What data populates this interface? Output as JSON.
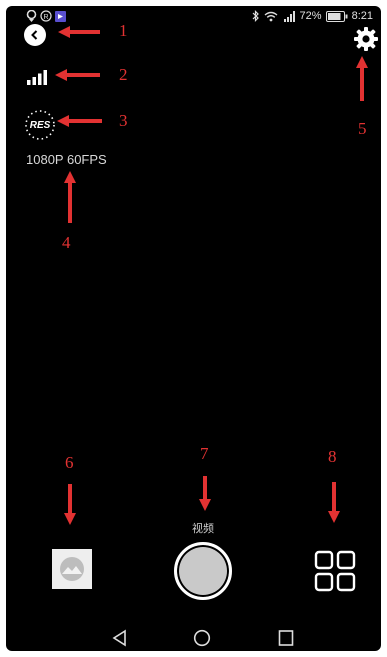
{
  "status_bar": {
    "battery_percent": "72%",
    "time": "8:21"
  },
  "camera": {
    "resolution_badge": "RES",
    "resolution_text": "1080P 60FPS",
    "mode_label": "视频"
  },
  "annotations": {
    "labels": [
      "1",
      "2",
      "3",
      "4",
      "5",
      "6",
      "7",
      "8"
    ],
    "color": "#e23232"
  },
  "icons": {
    "back": "back-arrow-icon",
    "signal": "signal-strength-icon",
    "resolution": "resolution-icon",
    "settings": "gear-icon",
    "gallery": "gallery-icon",
    "shutter": "shutter-button",
    "grid": "grid-icon",
    "nav_back": "triangle-back-icon",
    "nav_home": "circle-home-icon",
    "nav_recents": "square-recents-icon"
  }
}
